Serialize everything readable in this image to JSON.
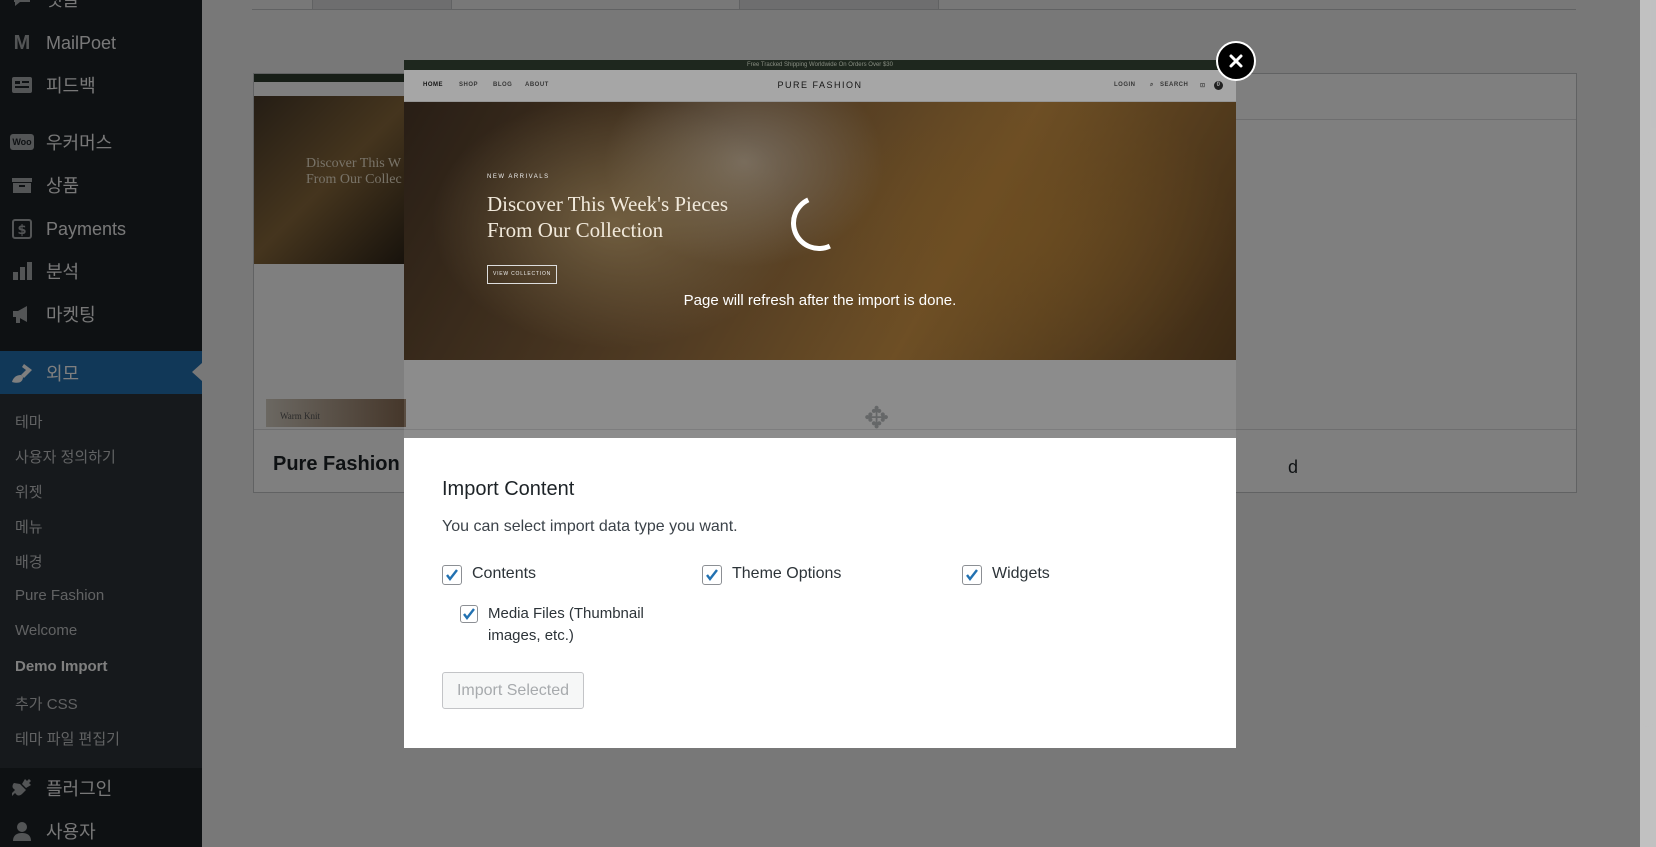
{
  "sidebar": {
    "items": [
      {
        "label": "댓글",
        "icon": "comment-icon"
      },
      {
        "label": "MailPoet",
        "icon": "mailpoet-icon"
      },
      {
        "label": "피드백",
        "icon": "feedback-icon"
      },
      {
        "label": "우커머스",
        "icon": "woo-icon",
        "badge": "Woo"
      },
      {
        "label": "상품",
        "icon": "archive-icon"
      },
      {
        "label": "Payments",
        "icon": "payments-icon"
      },
      {
        "label": "분석",
        "icon": "bar-chart-icon"
      },
      {
        "label": "마켓팅",
        "icon": "megaphone-icon"
      },
      {
        "label": "외모",
        "icon": "paintbrush-icon"
      },
      {
        "label": "플러그인",
        "icon": "plugin-icon"
      },
      {
        "label": "사용자",
        "icon": "user-icon"
      }
    ],
    "submenu": [
      "테마",
      "사용자 정의하기",
      "위젯",
      "메뉴",
      "배경",
      "Pure Fashion",
      "Welcome",
      "Demo Import",
      "추가 CSS",
      "테마 파일 편집기"
    ]
  },
  "background": {
    "theme_name": "Pure Fashion",
    "hero_text": "Discover This W From Our Collec",
    "thumb_caption": "Warm Knit",
    "right_partial": "d"
  },
  "modal": {
    "preview": {
      "topbar": "Free Tracked Shipping Worldwide On Orders Over $30",
      "brand": "PURE FASHION",
      "nav": [
        "HOME",
        "SHOP",
        "BLOG",
        "ABOUT"
      ],
      "nav_right": [
        "LOGIN",
        "SEARCH"
      ],
      "cart_count": "0",
      "eyebrow": "NEW ARRIVALS",
      "hero_title": "Discover This Week's Pieces From Our Collection",
      "hero_button": "VIEW COLLECTION"
    },
    "loading_message": "Page will refresh after the import is done.",
    "title": "Import Content",
    "description": "You can select import data type you want.",
    "options": {
      "contents": {
        "label": "Contents",
        "checked": true
      },
      "theme_options": {
        "label": "Theme Options",
        "checked": true
      },
      "widgets": {
        "label": "Widgets",
        "checked": true
      },
      "media": {
        "label": "Media Files (Thumbnail images, etc.)",
        "checked": true
      }
    },
    "import_button": "Import Selected",
    "close_icon": "close-icon"
  },
  "colors": {
    "sidebar_bg": "#1d2327",
    "accent": "#2271b1",
    "check": "#2271b1"
  }
}
